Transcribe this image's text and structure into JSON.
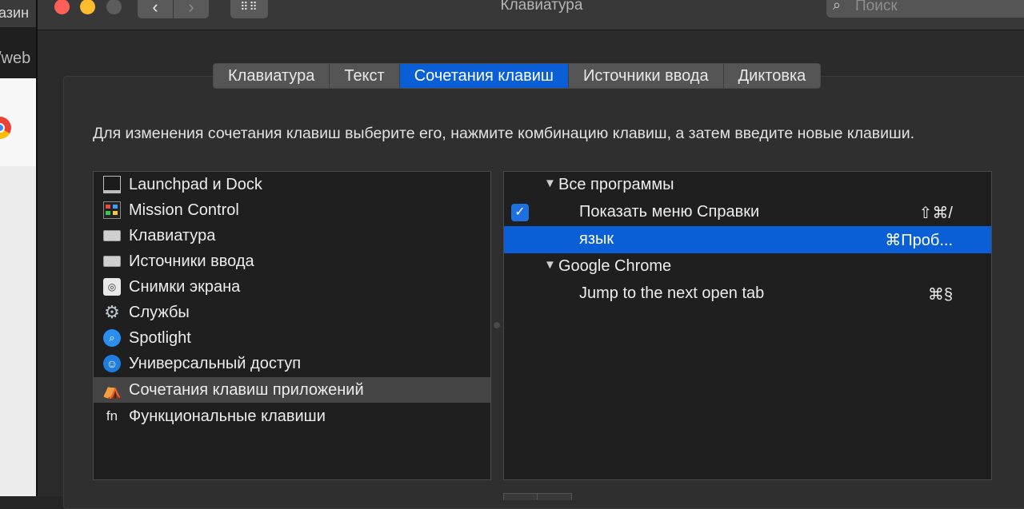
{
  "background_window": {
    "tab_text": "азин",
    "url_text": "/web"
  },
  "window": {
    "title": "Клавиатура",
    "search_placeholder": "Поиск",
    "nav": {
      "back": "‹",
      "forward": "›",
      "grid": "⠿⠿"
    }
  },
  "tabs": [
    {
      "label": "Клавиатура",
      "active": false
    },
    {
      "label": "Текст",
      "active": false
    },
    {
      "label": "Сочетания клавиш",
      "active": true
    },
    {
      "label": "Источники ввода",
      "active": false
    },
    {
      "label": "Диктовка",
      "active": false
    }
  ],
  "instructions": "Для изменения сочетания клавиш выберите его, нажмите комбинацию клавиш, а затем введите новые клавиши.",
  "categories": [
    {
      "label": "Launchpad и Dock",
      "icon": "launchpad-icon"
    },
    {
      "label": "Mission Control",
      "icon": "mission-control-icon"
    },
    {
      "label": "Клавиатура",
      "icon": "keyboard-icon"
    },
    {
      "label": "Источники ввода",
      "icon": "keyboard-icon"
    },
    {
      "label": "Снимки экрана",
      "icon": "screenshot-icon"
    },
    {
      "label": "Службы",
      "icon": "gear-icon"
    },
    {
      "label": "Spotlight",
      "icon": "spotlight-icon"
    },
    {
      "label": "Универсальный доступ",
      "icon": "accessibility-icon"
    },
    {
      "label": "Сочетания клавиш приложений",
      "icon": "app-shortcuts-icon",
      "selected": true
    },
    {
      "label": "Функциональные клавиши",
      "icon": "fn-icon"
    }
  ],
  "shortcuts": {
    "groups": [
      {
        "name": "Все программы",
        "items": [
          {
            "name": "Показать меню Справки",
            "keys": "⇧⌘/",
            "checked": true
          },
          {
            "name": "язык",
            "keys": "⌘Проб...",
            "selected": true
          }
        ]
      },
      {
        "name": "Google Chrome",
        "items": [
          {
            "name": "Jump to the next open tab",
            "keys": "⌘§"
          }
        ]
      }
    ],
    "disclosure_glyph": "▼",
    "check_glyph": "✓"
  },
  "icon_glyphs": {
    "search": "⌕",
    "gear": "⚙",
    "spotlight": "⌕",
    "accessibility": "☺",
    "app": "⛺",
    "fn": "fn",
    "screenshot": "◎"
  }
}
